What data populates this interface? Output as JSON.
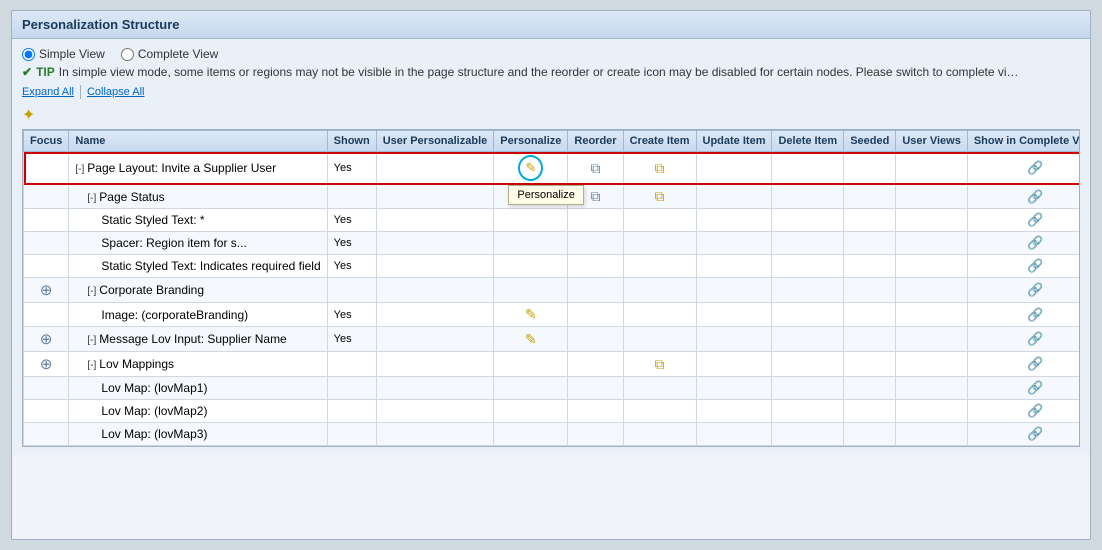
{
  "panel": {
    "title": "Personalization Structure"
  },
  "view_options": {
    "simple_view_label": "Simple View",
    "complete_view_label": "Complete View",
    "simple_checked": true
  },
  "tip": {
    "checkmark": "✔",
    "label": "TIP",
    "text": "In simple view mode, some items or regions may not be visible in the page structure and the reorder or create icon may be disabled for certain nodes. Please switch to complete view mode if you need full personalization of regions."
  },
  "expand_collapse": {
    "expand_label": "Expand All",
    "collapse_label": "Collapse All"
  },
  "table": {
    "columns": [
      "Focus",
      "Name",
      "Shown",
      "User Personalizable",
      "Personalize",
      "Reorder",
      "Create Item",
      "Update Item",
      "Delete Item",
      "Seeded",
      "User Views",
      "Show in Complete View"
    ],
    "rows": [
      {
        "focus": false,
        "indent": 0,
        "collapse": "[-]",
        "name": "Page Layout: Invite a Supplier User",
        "shown": "Yes",
        "user_pers": "",
        "personalize": "pencil",
        "personalize_highlighted": true,
        "reorder": "copy",
        "create": "copy",
        "update": "",
        "delete": "",
        "seeded": "",
        "user_views": "",
        "show_complete": "view",
        "row_highlight": true
      },
      {
        "focus": false,
        "indent": 1,
        "collapse": "[-]",
        "name": "Page Status",
        "shown": "",
        "user_pers": "",
        "personalize": "",
        "reorder": "copy",
        "create": "copy",
        "update": "",
        "delete": "",
        "seeded": "",
        "user_views": "",
        "show_complete": "view"
      },
      {
        "focus": false,
        "indent": 2,
        "collapse": "",
        "name": "Static Styled Text: *",
        "shown": "Yes",
        "user_pers": "",
        "personalize": "",
        "reorder": "",
        "create": "",
        "update": "",
        "delete": "",
        "seeded": "",
        "user_views": "",
        "show_complete": "view"
      },
      {
        "focus": false,
        "indent": 2,
        "collapse": "",
        "name": "Spacer: Region item for s...",
        "shown": "Yes",
        "user_pers": "",
        "personalize": "",
        "reorder": "",
        "create": "",
        "update": "",
        "delete": "",
        "seeded": "",
        "user_views": "",
        "show_complete": "view"
      },
      {
        "focus": false,
        "indent": 2,
        "collapse": "",
        "name": "Static Styled Text: Indicates required field",
        "shown": "Yes",
        "user_pers": "",
        "personalize": "",
        "reorder": "",
        "create": "",
        "update": "",
        "delete": "",
        "seeded": "",
        "user_views": "",
        "show_complete": "view"
      },
      {
        "focus": true,
        "indent": 1,
        "collapse": "[-]",
        "name": "Corporate Branding",
        "shown": "",
        "user_pers": "",
        "personalize": "",
        "reorder": "",
        "create": "",
        "update": "",
        "delete": "",
        "seeded": "",
        "user_views": "",
        "show_complete": "view"
      },
      {
        "focus": false,
        "indent": 2,
        "collapse": "",
        "name": "Image: (corporateBranding)",
        "shown": "Yes",
        "user_pers": "",
        "personalize": "pencil",
        "reorder": "",
        "create": "",
        "update": "",
        "delete": "",
        "seeded": "",
        "user_views": "",
        "show_complete": "view"
      },
      {
        "focus": true,
        "indent": 1,
        "collapse": "[-]",
        "name": "Message Lov Input: Supplier Name",
        "shown": "Yes",
        "user_pers": "",
        "personalize": "pencil",
        "reorder": "",
        "create": "",
        "update": "",
        "delete": "",
        "seeded": "",
        "user_views": "",
        "show_complete": "view"
      },
      {
        "focus": true,
        "indent": 1,
        "collapse": "[-]",
        "name": "Lov Mappings",
        "shown": "",
        "user_pers": "",
        "personalize": "",
        "reorder": "",
        "create": "copy",
        "update": "",
        "delete": "",
        "seeded": "",
        "user_views": "",
        "show_complete": "view"
      },
      {
        "focus": false,
        "indent": 2,
        "collapse": "",
        "name": "Lov Map: (lovMap1)",
        "shown": "",
        "user_pers": "",
        "personalize": "",
        "reorder": "",
        "create": "",
        "update": "",
        "delete": "",
        "seeded": "",
        "user_views": "",
        "show_complete": "view"
      },
      {
        "focus": false,
        "indent": 2,
        "collapse": "",
        "name": "Lov Map: (lovMap2)",
        "shown": "",
        "user_pers": "",
        "personalize": "",
        "reorder": "",
        "create": "",
        "update": "",
        "delete": "",
        "seeded": "",
        "user_views": "",
        "show_complete": "view"
      },
      {
        "focus": false,
        "indent": 2,
        "collapse": "",
        "name": "Lov Map: (lovMap3)",
        "shown": "",
        "user_pers": "",
        "personalize": "",
        "reorder": "",
        "create": "",
        "update": "",
        "delete": "",
        "seeded": "",
        "user_views": "",
        "show_complete": "view"
      }
    ]
  },
  "icons": {
    "pencil": "✎",
    "copy": "⧉",
    "view": "🔗",
    "move": "⊕",
    "gold_star": "✦"
  },
  "tooltip": {
    "personalize": "Personalize"
  }
}
